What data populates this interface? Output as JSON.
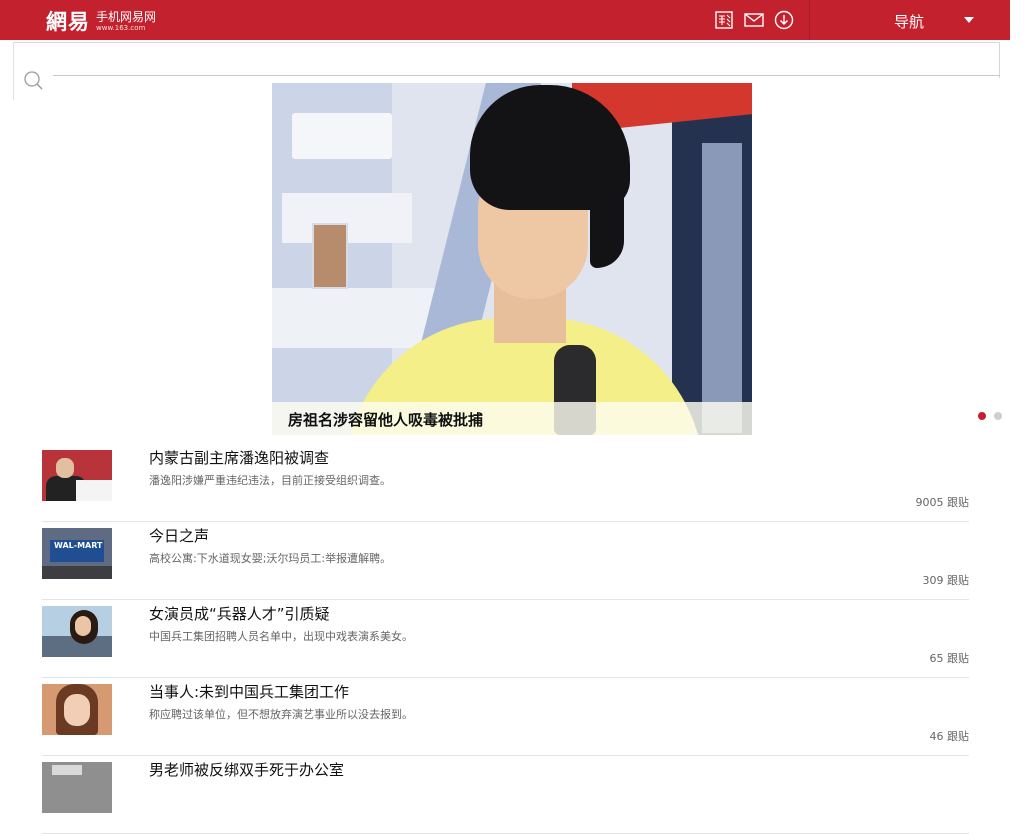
{
  "header": {
    "logo_mark": "網易",
    "logo_text": "手机网易网",
    "logo_url": "www.163.com",
    "icons": [
      "photo-icon",
      "mail-icon",
      "download-icon"
    ],
    "nav_label": "导航",
    "bg_color": "#c4212f"
  },
  "search": {
    "placeholder": "",
    "value": ""
  },
  "headline": {
    "caption": "房祖名涉容留他人吸毒被批捕",
    "slides_total": 2,
    "active_slide": 1
  },
  "news": [
    {
      "title": "内蒙古副主席潘逸阳被调查",
      "desc": "潘逸阳涉嫌严重违纪违法，目前正接受组织调查。",
      "count": "9005 跟贴"
    },
    {
      "title": "今日之声",
      "desc": "高校公寓:下水道现女婴;沃尔玛员工:举报遭解聘。",
      "count": "309 跟贴",
      "thumb_text": "WAL-MART"
    },
    {
      "title": "女演员成“兵器人才”引质疑",
      "desc": "中国兵工集团招聘人员名单中，出现中戏表演系美女。",
      "count": "65 跟贴"
    },
    {
      "title": "当事人:未到中国兵工集团工作",
      "desc": "称应聘过该单位，但不想放弃演艺事业所以没去报到。",
      "count": "46 跟贴"
    },
    {
      "title": "男老师被反绑双手死于办公室",
      "desc": "",
      "count": ""
    }
  ]
}
